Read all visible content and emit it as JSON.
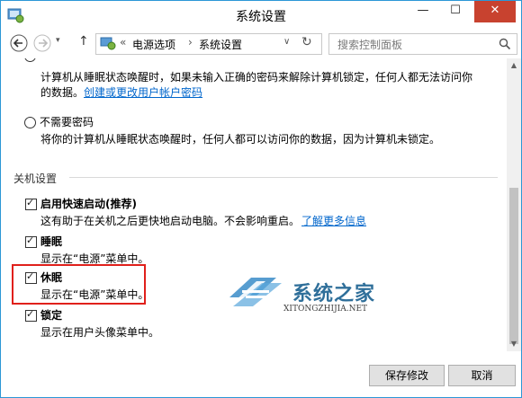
{
  "window": {
    "title": "系统设置",
    "minimize_glyph": "—",
    "maximize_glyph": "☐",
    "close_glyph": "✕"
  },
  "nav": {
    "back_glyph": "←",
    "forward_glyph": "→",
    "dropdown_glyph": "▾",
    "up_glyph": "↑",
    "overflow_glyph": "«",
    "breadcrumbs": [
      "电源选项",
      "系统设置"
    ],
    "breadcrumb_sep": "›",
    "addr_dropdown_glyph": "∨",
    "refresh_glyph": "↻",
    "search_placeholder": "搜索控制面板",
    "search_icon": "search-icon"
  },
  "password": {
    "line1": "计算机从睡眠状态唤醒时，如果未输入正确的密码来解除计算机锁定，任何人都无法访问你",
    "line2_prefix": "的数据。",
    "line2_link": "创建或更改用户帐户密码",
    "no_password_label": "不需要密码",
    "no_password_desc": "将你的计算机从睡眠状态唤醒时，任何人都可以访问你的数据，因为计算机未锁定。"
  },
  "shutdown": {
    "section_title": "关机设置",
    "items": [
      {
        "label": "启用快速启动(推荐)",
        "desc": "这有助于在关机之后更快地启动电脑。不会影响重启。",
        "link": "了解更多信息",
        "checked": true
      },
      {
        "label": "睡眠",
        "desc": "显示在“电源”菜单中。",
        "checked": true
      },
      {
        "label": "休眠",
        "desc": "显示在“电源”菜单中。",
        "checked": true
      },
      {
        "label": "锁定",
        "desc": "显示在用户头像菜单中。",
        "checked": true
      }
    ],
    "check_glyph": "✓"
  },
  "footer": {
    "save_label": "保存修改",
    "cancel_label": "取消"
  },
  "watermark": {
    "cn": "系统之家",
    "en": "XITONGZHIJIA.NET"
  },
  "colors": {
    "link": "#0066cc",
    "highlight_border": "#e0201b",
    "close_button": "#c8422f"
  }
}
